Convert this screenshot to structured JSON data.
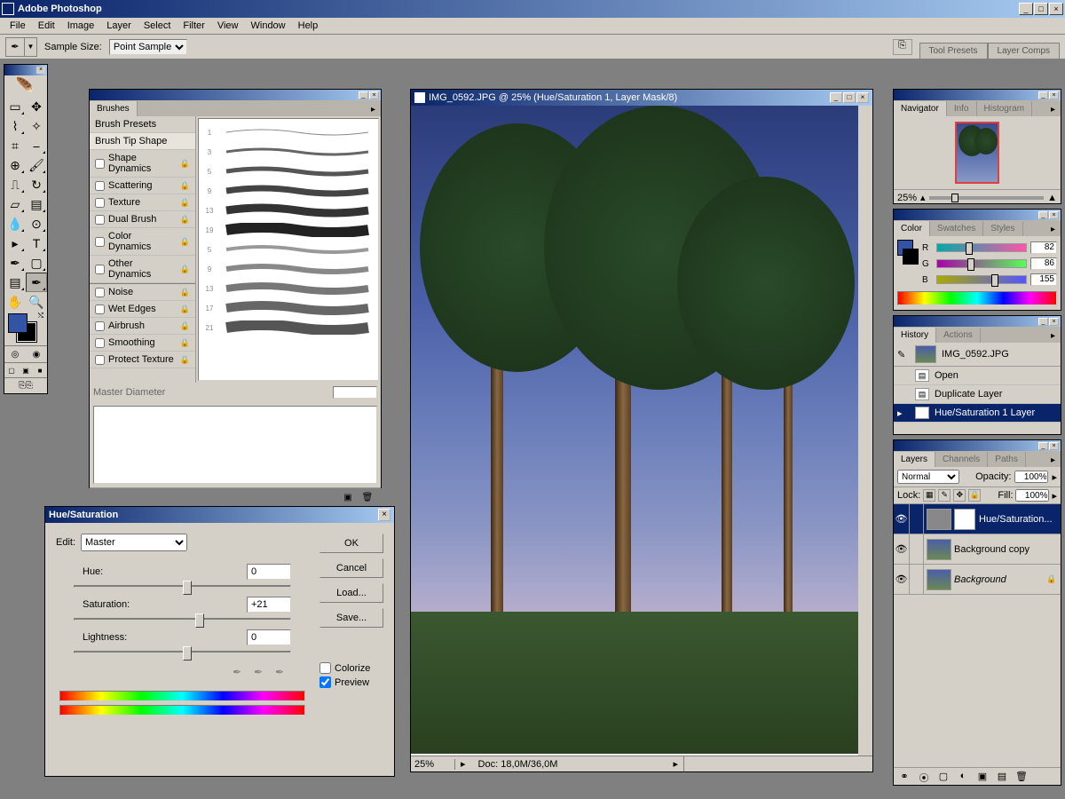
{
  "app": {
    "title": "Adobe Photoshop"
  },
  "menubar": [
    "File",
    "Edit",
    "Image",
    "Layer",
    "Select",
    "Filter",
    "View",
    "Window",
    "Help"
  ],
  "optionsbar": {
    "sample_label": "Sample Size:",
    "sample_value": "Point Sample",
    "dock_tabs": [
      "Tool Presets",
      "Layer Comps"
    ]
  },
  "brushes": {
    "title": "Brushes",
    "presets_label": "Brush Presets",
    "options": [
      {
        "label": "Brush Tip Shape",
        "checked": null
      },
      {
        "label": "Shape Dynamics",
        "checked": false
      },
      {
        "label": "Scattering",
        "checked": false
      },
      {
        "label": "Texture",
        "checked": false
      },
      {
        "label": "Dual Brush",
        "checked": false
      },
      {
        "label": "Color Dynamics",
        "checked": false
      },
      {
        "label": "Other Dynamics",
        "checked": false
      },
      {
        "label": "Noise",
        "checked": false,
        "sep": true
      },
      {
        "label": "Wet Edges",
        "checked": false
      },
      {
        "label": "Airbrush",
        "checked": false
      },
      {
        "label": "Smoothing",
        "checked": false
      },
      {
        "label": "Protect Texture",
        "checked": false
      }
    ],
    "sizes": [
      1,
      3,
      5,
      9,
      13,
      19,
      5,
      9,
      13,
      17,
      21
    ],
    "master_label": "Master Diameter"
  },
  "document": {
    "title": "IMG_0592.JPG @ 25% (Hue/Saturation 1, Layer Mask/8)",
    "zoom": "25%",
    "doc_info": "Doc: 18,0M/36,0M"
  },
  "navigator": {
    "tabs": [
      "Navigator",
      "Info",
      "Histogram"
    ],
    "zoom": "25%"
  },
  "color": {
    "tabs": [
      "Color",
      "Swatches",
      "Styles"
    ],
    "r": 82,
    "g": 86,
    "b": 155,
    "fg": "#3353a5",
    "bg": "#000000"
  },
  "history": {
    "tabs": [
      "History",
      "Actions"
    ],
    "doc_name": "IMG_0592.JPG",
    "items": [
      {
        "label": "Open",
        "sel": false
      },
      {
        "label": "Duplicate Layer",
        "sel": false
      },
      {
        "label": "Hue/Saturation 1 Layer",
        "sel": true
      }
    ]
  },
  "layers": {
    "tabs": [
      "Layers",
      "Channels",
      "Paths"
    ],
    "blend_mode": "Normal",
    "opacity_label": "Opacity:",
    "opacity": "100%",
    "lock_label": "Lock:",
    "fill_label": "Fill:",
    "fill": "100%",
    "items": [
      {
        "name": "Hue/Saturation...",
        "sel": true,
        "mask": true,
        "adj": true
      },
      {
        "name": "Background copy",
        "sel": false
      },
      {
        "name": "Background",
        "sel": false,
        "italic": true,
        "locked": true
      }
    ]
  },
  "huesat": {
    "title": "Hue/Saturation",
    "edit_label": "Edit:",
    "edit_value": "Master",
    "hue_label": "Hue:",
    "hue_value": "0",
    "sat_label": "Saturation:",
    "sat_value": "+21",
    "light_label": "Lightness:",
    "light_value": "0",
    "ok": "OK",
    "cancel": "Cancel",
    "load": "Load...",
    "save": "Save...",
    "colorize": "Colorize",
    "preview": "Preview"
  }
}
